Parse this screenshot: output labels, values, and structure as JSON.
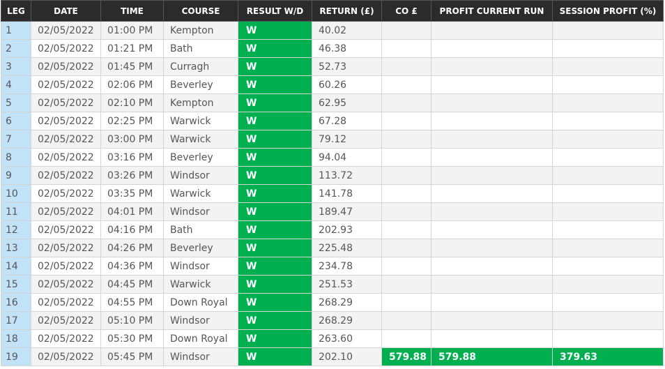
{
  "headers": [
    "LEG",
    "DATE",
    "TIME",
    "COURSE",
    "RESULT W/D",
    "RETURN (£)",
    "CO £",
    "PROFIT CURRENT RUN",
    "SESSION PROFIT (%)"
  ],
  "rows": [
    {
      "leg": "1",
      "date": "02/05/2022",
      "time": "01:00 PM",
      "course": "Kempton",
      "result": "W",
      "return": "40.02",
      "co": "",
      "profit_run": "",
      "session": ""
    },
    {
      "leg": "2",
      "date": "02/05/2022",
      "time": "01:21 PM",
      "course": "Bath",
      "result": "W",
      "return": "46.38",
      "co": "",
      "profit_run": "",
      "session": ""
    },
    {
      "leg": "3",
      "date": "02/05/2022",
      "time": "01:45 PM",
      "course": "Curragh",
      "result": "W",
      "return": "52.73",
      "co": "",
      "profit_run": "",
      "session": ""
    },
    {
      "leg": "4",
      "date": "02/05/2022",
      "time": "02:06 PM",
      "course": "Beverley",
      "result": "W",
      "return": "60.26",
      "co": "",
      "profit_run": "",
      "session": ""
    },
    {
      "leg": "5",
      "date": "02/05/2022",
      "time": "02:10 PM",
      "course": "Kempton",
      "result": "W",
      "return": "62.95",
      "co": "",
      "profit_run": "",
      "session": ""
    },
    {
      "leg": "6",
      "date": "02/05/2022",
      "time": "02:25 PM",
      "course": "Warwick",
      "result": "W",
      "return": "67.28",
      "co": "",
      "profit_run": "",
      "session": ""
    },
    {
      "leg": "7",
      "date": "02/05/2022",
      "time": "03:00 PM",
      "course": "Warwick",
      "result": "W",
      "return": "79.12",
      "co": "",
      "profit_run": "",
      "session": ""
    },
    {
      "leg": "8",
      "date": "02/05/2022",
      "time": "03:16 PM",
      "course": "Beverley",
      "result": "W",
      "return": "94.04",
      "co": "",
      "profit_run": "",
      "session": ""
    },
    {
      "leg": "9",
      "date": "02/05/2022",
      "time": "03:26 PM",
      "course": "Windsor",
      "result": "W",
      "return": "113.72",
      "co": "",
      "profit_run": "",
      "session": ""
    },
    {
      "leg": "10",
      "date": "02/05/2022",
      "time": "03:35 PM",
      "course": "Warwick",
      "result": "W",
      "return": "141.78",
      "co": "",
      "profit_run": "",
      "session": ""
    },
    {
      "leg": "11",
      "date": "02/05/2022",
      "time": "04:01 PM",
      "course": "Windsor",
      "result": "W",
      "return": "189.47",
      "co": "",
      "profit_run": "",
      "session": ""
    },
    {
      "leg": "12",
      "date": "02/05/2022",
      "time": "04:16 PM",
      "course": "Bath",
      "result": "W",
      "return": "202.93",
      "co": "",
      "profit_run": "",
      "session": ""
    },
    {
      "leg": "13",
      "date": "02/05/2022",
      "time": "04:26 PM",
      "course": "Beverley",
      "result": "W",
      "return": "225.48",
      "co": "",
      "profit_run": "",
      "session": ""
    },
    {
      "leg": "14",
      "date": "02/05/2022",
      "time": "04:36 PM",
      "course": "Windsor",
      "result": "W",
      "return": "234.78",
      "co": "",
      "profit_run": "",
      "session": ""
    },
    {
      "leg": "15",
      "date": "02/05/2022",
      "time": "04:45 PM",
      "course": "Warwick",
      "result": "W",
      "return": "251.53",
      "co": "",
      "profit_run": "",
      "session": ""
    },
    {
      "leg": "16",
      "date": "02/05/2022",
      "time": "04:55 PM",
      "course": "Down Royal",
      "result": "W",
      "return": "268.29",
      "co": "",
      "profit_run": "",
      "session": ""
    },
    {
      "leg": "17",
      "date": "02/05/2022",
      "time": "05:10 PM",
      "course": "Windsor",
      "result": "W",
      "return": "268.29",
      "co": "",
      "profit_run": "",
      "session": ""
    },
    {
      "leg": "18",
      "date": "02/05/2022",
      "time": "05:30 PM",
      "course": "Down Royal",
      "result": "W",
      "return": "263.60",
      "co": "",
      "profit_run": "",
      "session": ""
    },
    {
      "leg": "19",
      "date": "02/05/2022",
      "time": "05:45 PM",
      "course": "Windsor",
      "result": "W",
      "return": "202.10",
      "co": "579.88",
      "profit_run": "579.88",
      "session": "379.63"
    }
  ],
  "colors": {
    "header_bg": "#2b2b2b",
    "win_green": "#00b050",
    "leg_blue": "#c2e2f7",
    "stripe": "#f3f3f3"
  }
}
